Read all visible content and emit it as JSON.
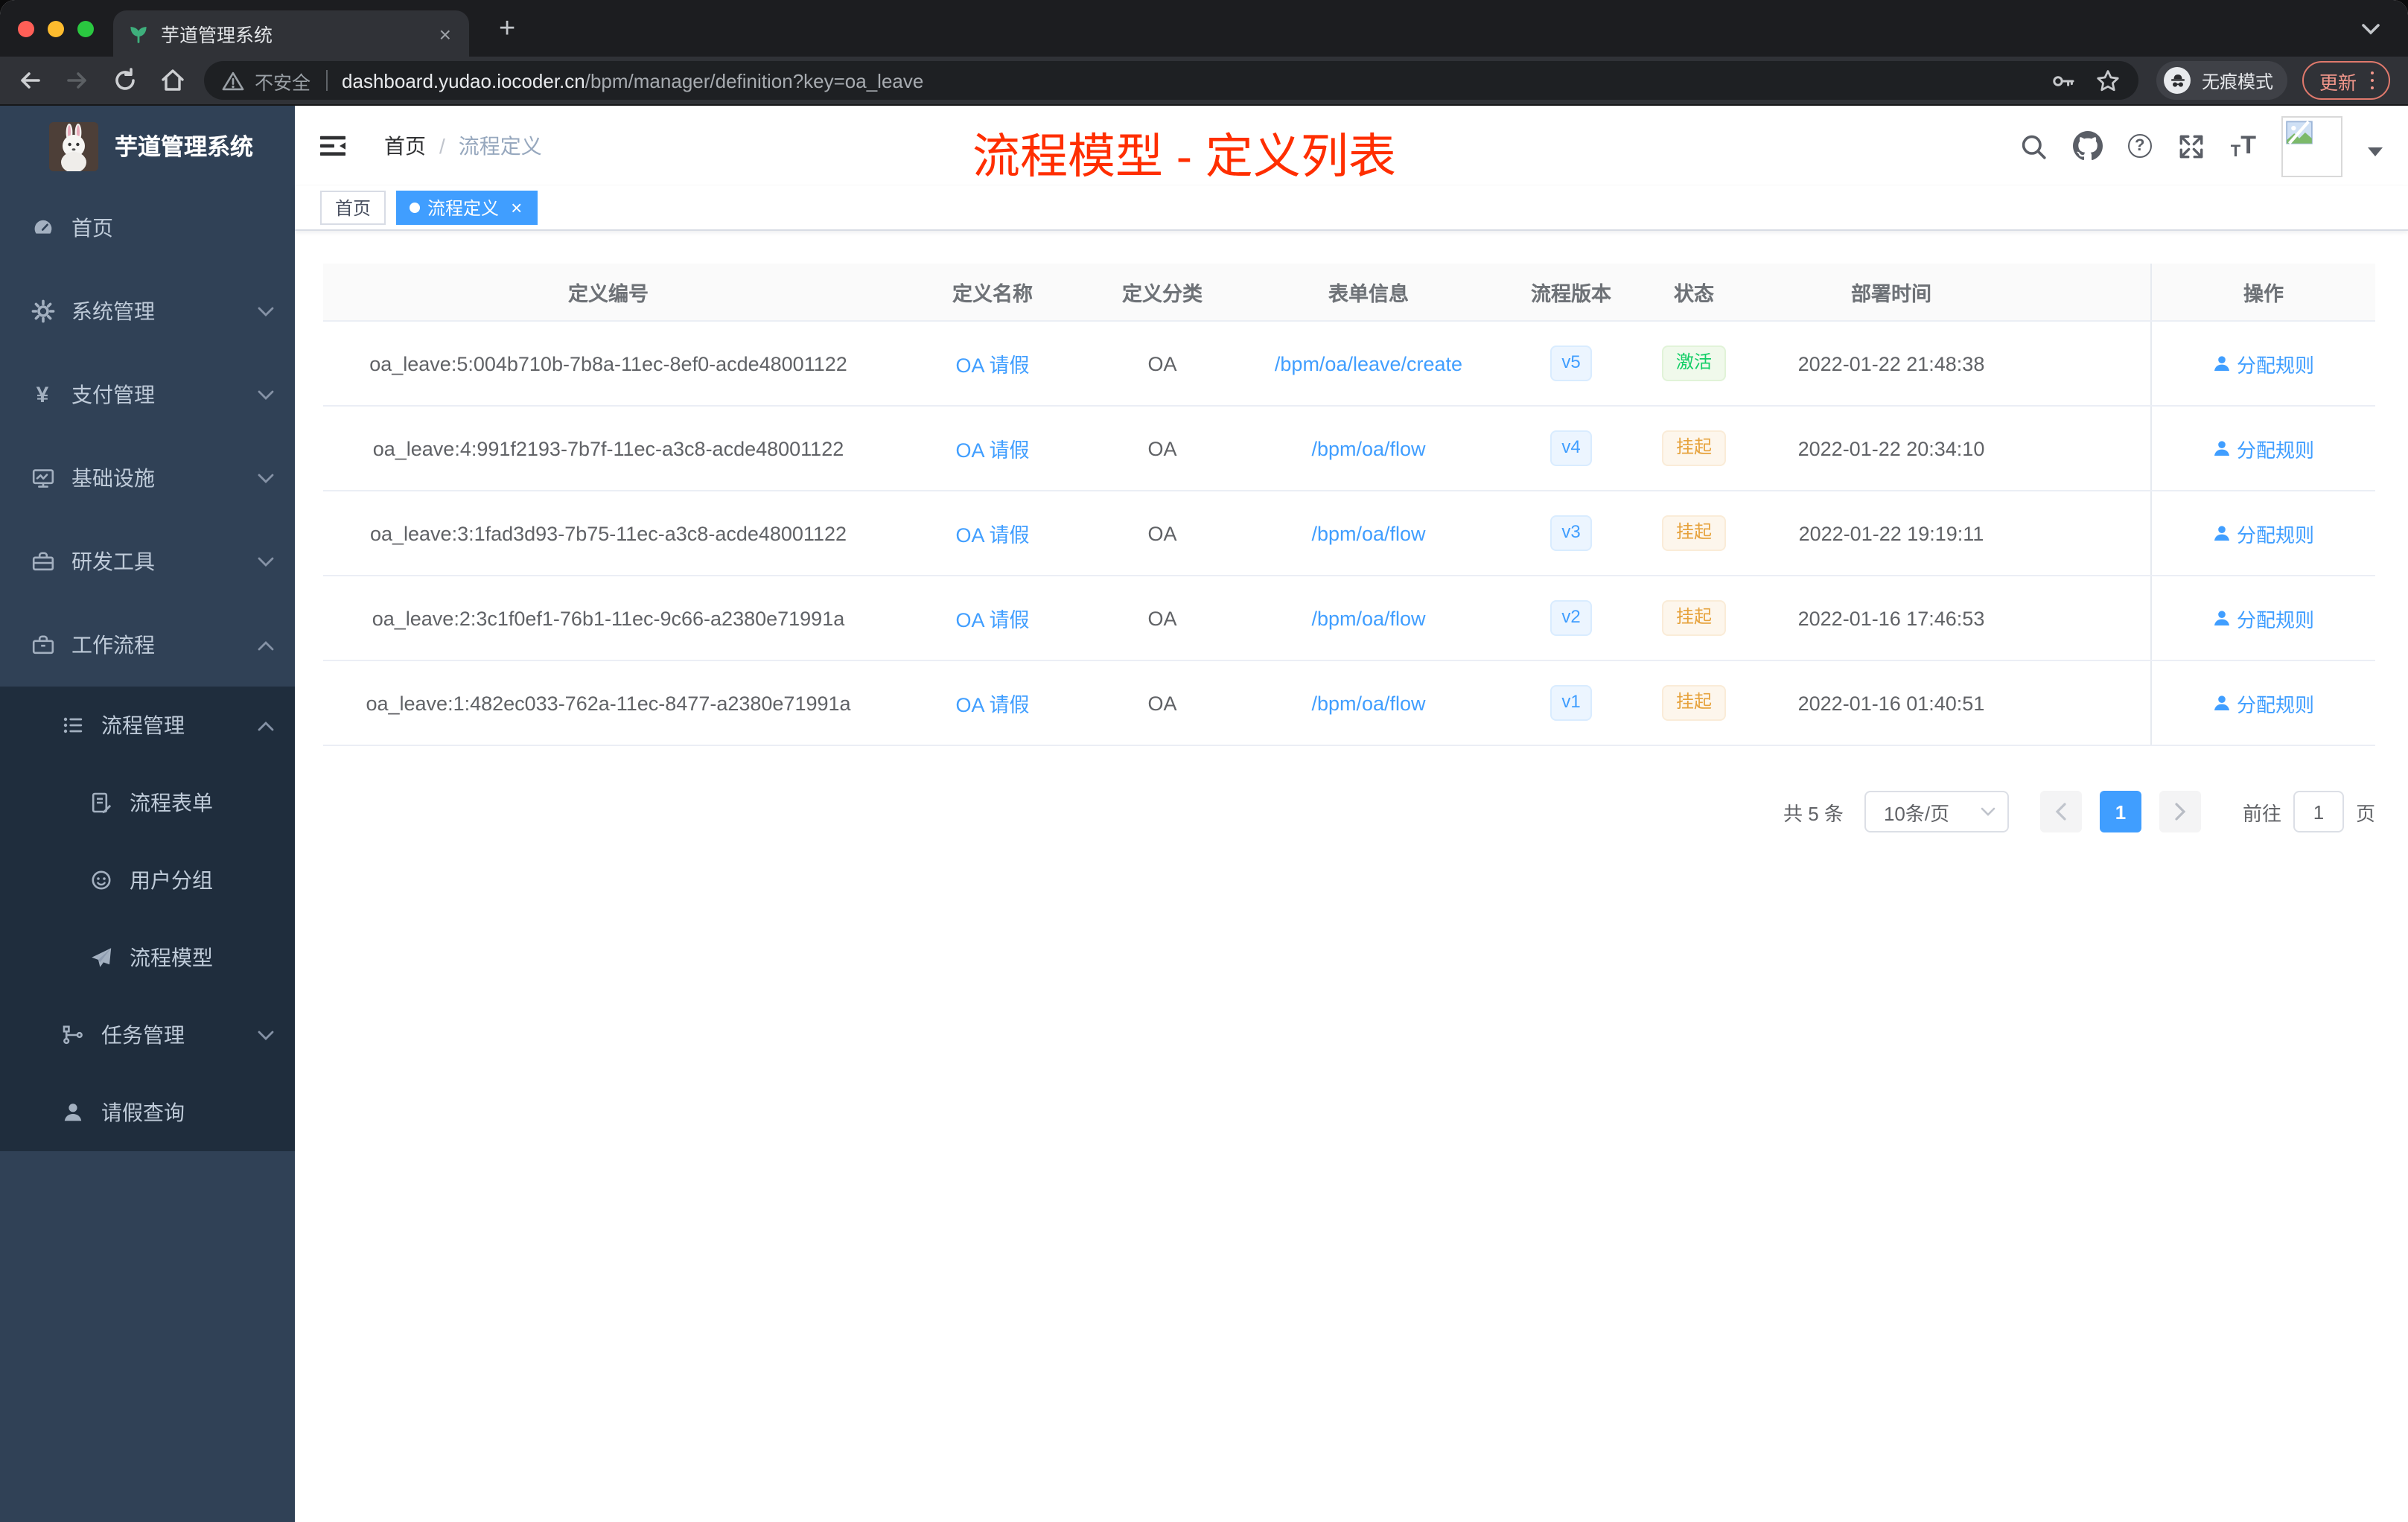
{
  "browser": {
    "tab_title": "芋道管理系统",
    "close_glyph": "×",
    "new_tab_glyph": "+",
    "security_text": "不安全",
    "url_domain": "dashboard.yudao.iocoder.cn",
    "url_path": "/bpm/manager/definition?key=oa_leave",
    "incognito_label": "无痕模式",
    "update_label": "更新"
  },
  "sidebar": {
    "logo_title": "芋道管理系统",
    "yen_glyph": "¥",
    "items": [
      {
        "label": "首页"
      },
      {
        "label": "系统管理"
      },
      {
        "label": "支付管理"
      },
      {
        "label": "基础设施"
      },
      {
        "label": "研发工具"
      },
      {
        "label": "工作流程"
      },
      {
        "label": "流程管理"
      },
      {
        "label": "流程表单"
      },
      {
        "label": "用户分组"
      },
      {
        "label": "流程模型"
      },
      {
        "label": "任务管理"
      },
      {
        "label": "请假查询"
      }
    ]
  },
  "header": {
    "breadcrumb_home": "首页",
    "breadcrumb_separator": "/",
    "breadcrumb_current": "流程定义",
    "annotation": "流程模型 - 定义列表",
    "question_glyph": "?",
    "font_icon_small": "T",
    "font_icon_large": "T"
  },
  "tags": {
    "home": "首页",
    "active": "流程定义",
    "close_glyph": "×"
  },
  "table": {
    "headers": [
      "定义编号",
      "定义名称",
      "定义分类",
      "表单信息",
      "流程版本",
      "状态",
      "部署时间",
      "操作"
    ],
    "rows": [
      {
        "id": "oa_leave:5:004b710b-7b8a-11ec-8ef0-acde48001122",
        "name": "OA 请假",
        "category": "OA",
        "form": "/bpm/oa/leave/create",
        "version": "v5",
        "status": "激活",
        "status_type": "success",
        "deployed": "2022-01-22 21:48:38",
        "action": "分配规则"
      },
      {
        "id": "oa_leave:4:991f2193-7b7f-11ec-a3c8-acde48001122",
        "name": "OA 请假",
        "category": "OA",
        "form": "/bpm/oa/flow",
        "version": "v4",
        "status": "挂起",
        "status_type": "warning",
        "deployed": "2022-01-22 20:34:10",
        "action": "分配规则"
      },
      {
        "id": "oa_leave:3:1fad3d93-7b75-11ec-a3c8-acde48001122",
        "name": "OA 请假",
        "category": "OA",
        "form": "/bpm/oa/flow",
        "version": "v3",
        "status": "挂起",
        "status_type": "warning",
        "deployed": "2022-01-22 19:19:11",
        "action": "分配规则"
      },
      {
        "id": "oa_leave:2:3c1f0ef1-76b1-11ec-9c66-a2380e71991a",
        "name": "OA 请假",
        "category": "OA",
        "form": "/bpm/oa/flow",
        "version": "v2",
        "status": "挂起",
        "status_type": "warning",
        "deployed": "2022-01-16 17:46:53",
        "action": "分配规则"
      },
      {
        "id": "oa_leave:1:482ec033-762a-11ec-8477-a2380e71991a",
        "name": "OA 请假",
        "category": "OA",
        "form": "/bpm/oa/flow",
        "version": "v1",
        "status": "挂起",
        "status_type": "warning",
        "deployed": "2022-01-16 01:40:51",
        "action": "分配规则"
      }
    ]
  },
  "pagination": {
    "total": "共 5 条",
    "page_size": "10条/页",
    "current_page": "1",
    "goto_label": "前往",
    "goto_value": "1",
    "goto_suffix": "页"
  },
  "colors": {
    "accent": "#409eff",
    "sidebar_bg": "#304156",
    "submenu_bg": "#1f2d3d",
    "success": "#13ce66",
    "warning": "#e6a23c",
    "annotation_red": "#ff2e00"
  }
}
